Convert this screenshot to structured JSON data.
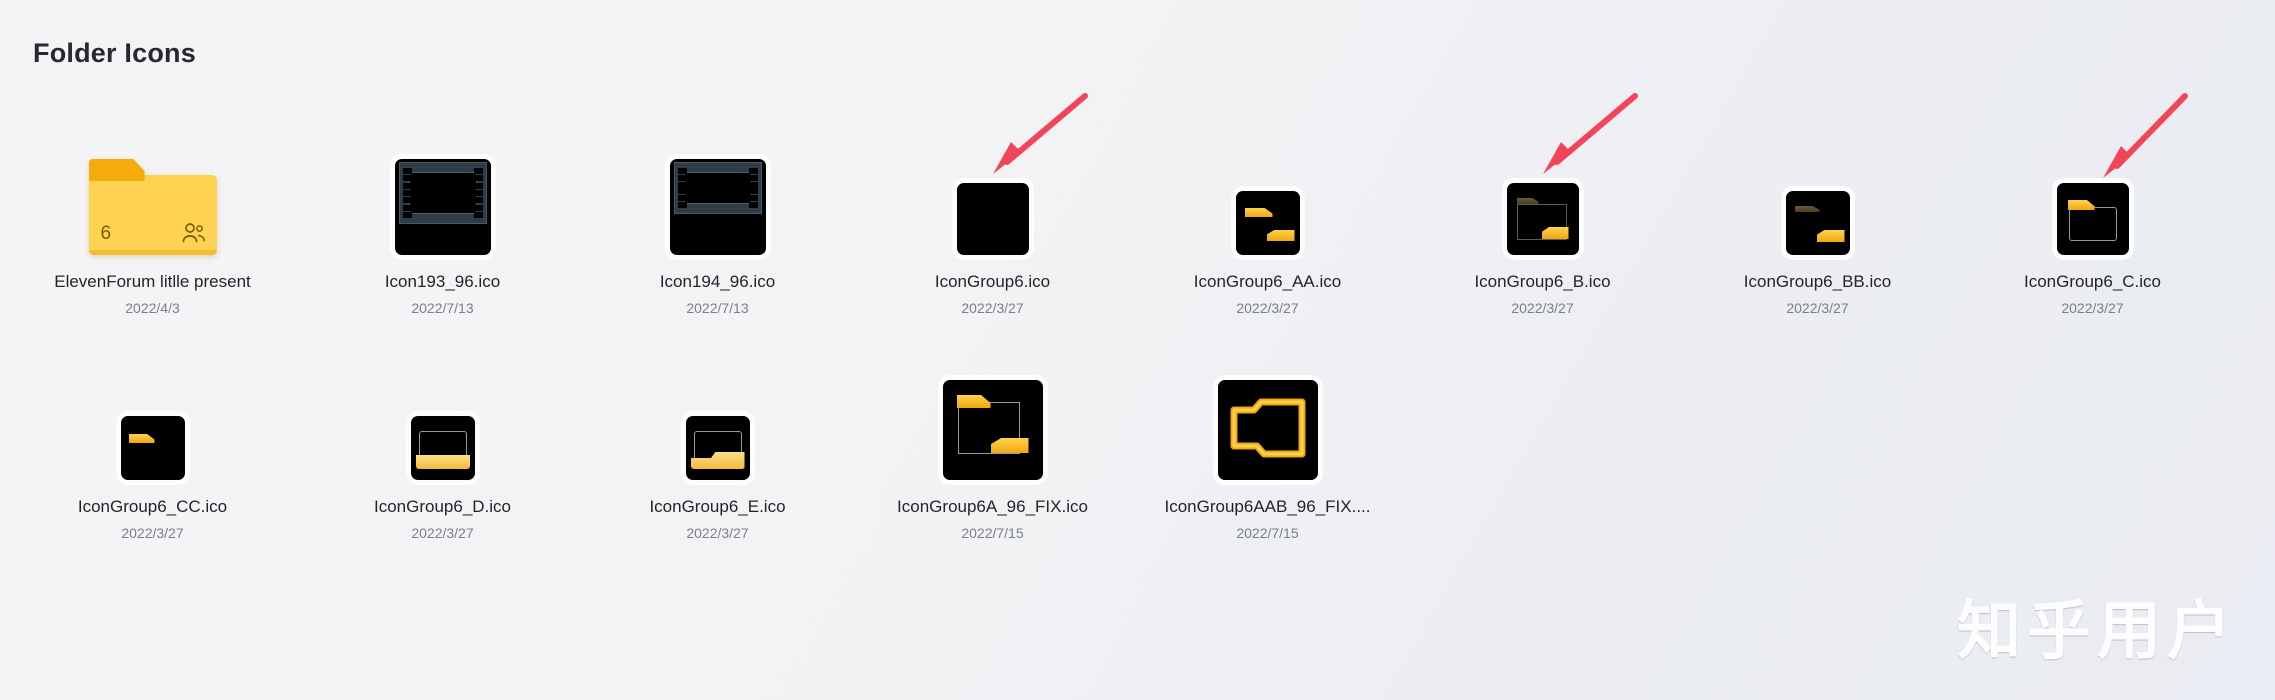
{
  "page": {
    "title": "Folder Icons",
    "watermark": "知乎用户",
    "background_color": "#f2f3f6",
    "accent_yellow": "#f5b71d",
    "arrow_color": "#f2455a"
  },
  "rows": [
    {
      "items": [
        {
          "name": "ElevenForum litlle present",
          "date": "2022/4/3",
          "kind": "classic-folder",
          "badge_count": "6",
          "badge_icon": "people-shared-icon",
          "arrow": false
        },
        {
          "name": "Icon193_96.ico",
          "date": "2022/7/13",
          "kind": "film-strip-tall",
          "arrow": false
        },
        {
          "name": "Icon194_96.ico",
          "date": "2022/7/13",
          "kind": "film-strip-short",
          "arrow": false
        },
        {
          "name": "IconGroup6.ico",
          "date": "2022/3/27",
          "kind": "blank-black",
          "arrow": true
        },
        {
          "name": "IconGroup6_AA.ico",
          "date": "2022/3/27",
          "kind": "tab-and-flap",
          "arrow": false
        },
        {
          "name": "IconGroup6_B.ico",
          "date": "2022/3/27",
          "kind": "outline-dimtab-flap",
          "arrow": true
        },
        {
          "name": "IconGroup6_BB.ico",
          "date": "2022/3/27",
          "kind": "dimtab-and-flap",
          "arrow": false
        },
        {
          "name": "IconGroup6_C.ico",
          "date": "2022/3/27",
          "kind": "outline-yellowtab",
          "arrow": true
        }
      ]
    },
    {
      "items": [
        {
          "name": "IconGroup6_CC.ico",
          "date": "2022/3/27",
          "kind": "tab-only",
          "arrow": false
        },
        {
          "name": "IconGroup6_D.ico",
          "date": "2022/3/27",
          "kind": "outline-band",
          "arrow": false
        },
        {
          "name": "IconGroup6_E.ico",
          "date": "2022/3/27",
          "kind": "outline-stepband",
          "arrow": false
        },
        {
          "name": "IconGroup6A_96_FIX.ico",
          "date": "2022/7/15",
          "kind": "outline-tab-flap-big",
          "arrow": false
        },
        {
          "name": "IconGroup6AAB_96_FIX....",
          "date": "2022/7/15",
          "kind": "full-yellow-folder",
          "arrow": false
        }
      ]
    }
  ]
}
